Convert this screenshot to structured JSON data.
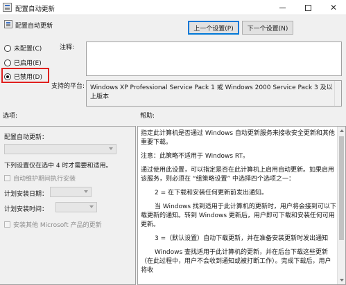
{
  "window": {
    "title": "配置自动更新",
    "header_title": "配置自动更新"
  },
  "nav": {
    "prev_label": "上一个设置(P)",
    "next_label": "下一个设置(N)"
  },
  "state": {
    "options": [
      {
        "label": "未配置(C)",
        "checked": false
      },
      {
        "label": "已启用(E)",
        "checked": false
      },
      {
        "label": "已禁用(D)",
        "checked": true
      }
    ]
  },
  "fields": {
    "note_label": "注释:",
    "note_value": "",
    "platform_label": "支持的平台:",
    "platform_value": "Windows XP Professional Service Pack 1 或 Windows 2000 Service Pack 3 及以上版本"
  },
  "sections": {
    "options_label": "选项:",
    "help_label": "帮助:"
  },
  "options_panel": {
    "configure_label": "配置自动更新：",
    "note_text": "下列设置仅在选中 4 时才需要和适用。",
    "maintenance_label": "自动维护期间执行安装",
    "schedule_day_label": "计划安装日期：",
    "schedule_time_label": "计划安装时间：",
    "other_products_label": "安装其他 Microsoft 产品的更新"
  },
  "help": {
    "paragraphs": [
      "指定此计算机是否通过 Windows 自动更新服务来接收安全更新和其他重要下载。",
      "注意：此策略不适用于 Windows RT。",
      "通过使用此设置，可以指定是否在此计算机上启用自动更新。如果启用该服务，则必须在 “组策略设置” 中选择四个选项之一：",
      "2 = 在下载和安装任何更新前发出通知。",
      "当 Windows 找到适用于此计算机的更新时，用户将会接到可以下载更新的通知。转到 Windows 更新后，用户即可下载和安装任何可用更新。",
      "3 =（默认设置）自动下载更新，并在准备安装更新时发出通知",
      "Windows 查找适用于此计算机的更新，并在后台下载这些更新（在此过程中，用户不会收到通知或被打断工作）。完成下载后，用户将收"
    ]
  },
  "icons": {
    "app": "policy-icon",
    "minimize": "minimize-icon",
    "maximize": "maximize-icon",
    "close": "close-icon"
  },
  "colors": {
    "highlight_border": "#e0201e",
    "focus_border": "#0078d7"
  }
}
